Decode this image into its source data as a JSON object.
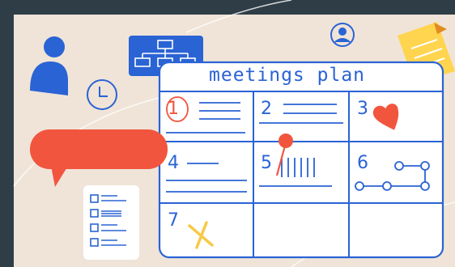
{
  "board": {
    "title": "meetings plan",
    "cells": [
      {
        "number": "1"
      },
      {
        "number": "2"
      },
      {
        "number": "3"
      },
      {
        "number": "4"
      },
      {
        "number": "5"
      },
      {
        "number": "6"
      },
      {
        "number": "7"
      }
    ]
  },
  "colors": {
    "background": "#f0e4d8",
    "frame": "#2f3e46",
    "accent_blue": "#2a63d4",
    "accent_red": "#f2553e",
    "accent_yellow": "#f7c948",
    "sticky_note": "#ffd44f"
  },
  "icons": [
    "user-icon",
    "org-chart-icon",
    "account-icon",
    "clock-icon",
    "sticky-note-icon",
    "speech-bubble-icon",
    "checklist-icon",
    "heart-icon",
    "pin-icon",
    "flow-icon",
    "cross-icon"
  ]
}
